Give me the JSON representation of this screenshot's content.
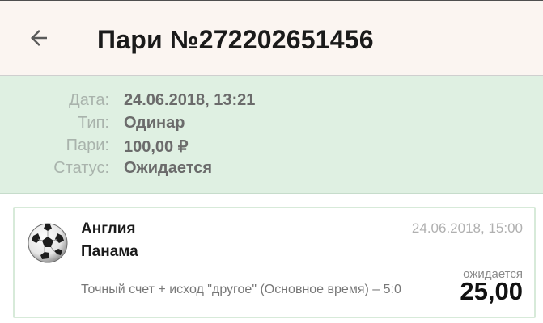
{
  "header": {
    "back_icon": "arrow-left-icon",
    "title": "Пари №272202651456"
  },
  "info": {
    "rows": [
      {
        "label": "Дата:",
        "value": "24.06.2018, 13:21"
      },
      {
        "label": "Тип:",
        "value": "Одинар"
      },
      {
        "label": "Пари:",
        "value": "100,00 ₽"
      },
      {
        "label": "Статус:",
        "value": "Ожидается"
      }
    ]
  },
  "event": {
    "sport_icon": "soccer-ball-icon",
    "team1": "Англия",
    "team2": "Панама",
    "date": "24.06.2018, 15:00",
    "bet_description": "Точный счет + исход \"другое\" (Основное время) – 5:0",
    "status": "ожидается",
    "odds": "25,00"
  },
  "colors": {
    "header_bg": "#fbf5f1",
    "info_bg": "#dff0e2",
    "card_border": "#d7ead9"
  }
}
